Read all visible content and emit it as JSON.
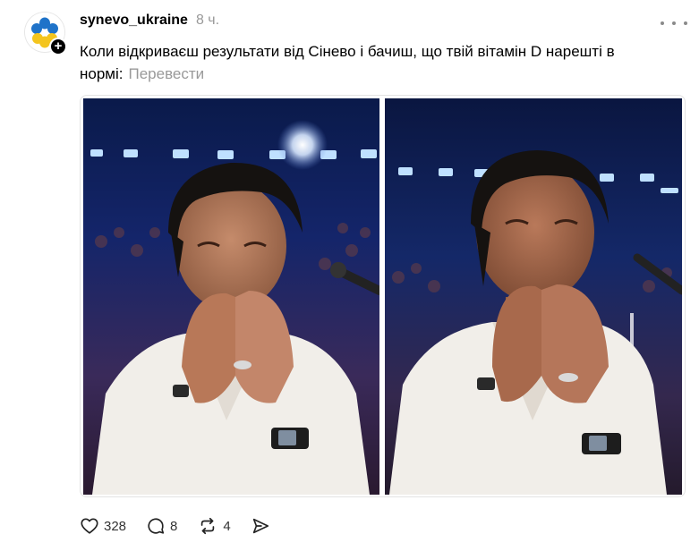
{
  "post": {
    "username": "synevo_ukraine",
    "time": "8 ч.",
    "caption": "Коли відкриваєш результати від Сінево і бачиш, що твій вітамін D нарешті в нормі:",
    "translate_label": "Перевести",
    "follow_badge": "+",
    "images": [
      {
        "alt": "Man in white suit covering his face with hands, laughing"
      },
      {
        "alt": "Man in white suit covering his face with hands, laughing, close-up"
      }
    ]
  },
  "actions": {
    "likes": "328",
    "comments": "8",
    "reposts": "4"
  },
  "icons": {
    "avatar_logo": "synevo-flower-logo",
    "like": "heart-icon",
    "comment": "comment-bubble-icon",
    "repost": "repost-arrows-icon",
    "share": "send-icon",
    "more": "more-dots-icon"
  },
  "colors": {
    "logo_blue": "#1f73c9",
    "logo_yellow": "#f4c51e",
    "muted_text": "#999999",
    "stage_background": "#0b1840",
    "suit_white": "#f1eee9"
  }
}
